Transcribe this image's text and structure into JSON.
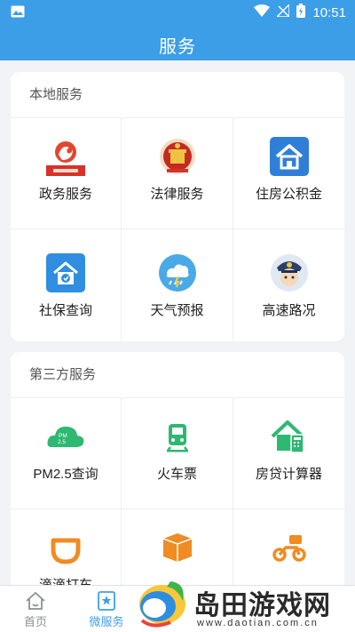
{
  "status_bar": {
    "time": "10:51"
  },
  "header": {
    "title": "服务"
  },
  "local_services": {
    "title": "本地服务",
    "items": [
      {
        "label": "政务服务",
        "icon": "government-service-icon"
      },
      {
        "label": "法律服务",
        "icon": "legal-service-icon"
      },
      {
        "label": "住房公积金",
        "icon": "housing-fund-icon"
      },
      {
        "label": "社保查询",
        "icon": "social-security-icon"
      },
      {
        "label": "天气预报",
        "icon": "weather-icon"
      },
      {
        "label": "高速路况",
        "icon": "traffic-police-icon"
      }
    ]
  },
  "third_party_services": {
    "title": "第三方服务",
    "items": [
      {
        "label": "PM2.5查询",
        "icon": "pm25-cloud-icon"
      },
      {
        "label": "火车票",
        "icon": "train-icon"
      },
      {
        "label": "房贷计算器",
        "icon": "mortgage-calculator-icon"
      },
      {
        "label": "滴滴打车",
        "icon": "didi-icon"
      },
      {
        "label": "",
        "icon": "package-icon"
      },
      {
        "label": "",
        "icon": "scooter-icon"
      }
    ]
  },
  "tabbar": {
    "home_label": "首页",
    "service_label": "微服务"
  },
  "watermark": {
    "text": "岛田游戏网",
    "url": "www.daotian.com.cn"
  },
  "colors": {
    "primary": "#3d9ee8",
    "background": "#f1f3f6",
    "green": "#2eb872",
    "orange": "#f08c22",
    "red": "#d6322a"
  }
}
